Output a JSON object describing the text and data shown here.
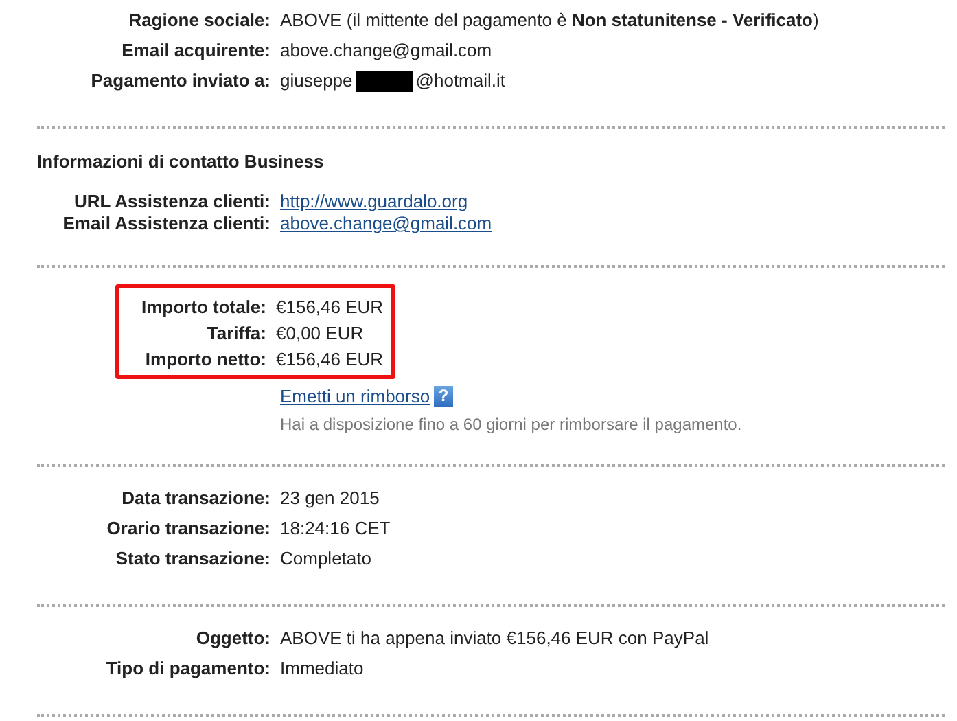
{
  "sections": [
    {
      "rows": [
        {
          "kind": "text",
          "label": "Ragione sociale:",
          "value": "ABOVE (il mittente del pagamento è **Non statunitense - Verificato**)"
        },
        {
          "kind": "text",
          "label": "Email acquirente:",
          "value": "above.change@gmail.com"
        },
        {
          "kind": "redacted",
          "label": "Pagamento inviato a:",
          "value": "giuseppe",
          "value_after": "@hotmail.it"
        }
      ]
    },
    {
      "heading": "Informazioni di contatto Business",
      "rows": [
        {
          "kind": "link",
          "label": "URL Assistenza clienti:",
          "value": "http://www.guardalo.org"
        },
        {
          "kind": "link",
          "label": "Email Assistenza clienti:",
          "value": "above.change@gmail.com"
        }
      ]
    },
    {
      "highlighted": true,
      "rows": [
        {
          "kind": "text",
          "label": "Importo totale:",
          "value": "€156,46 EUR"
        },
        {
          "kind": "text",
          "label": "Tariffa:",
          "value": "€0,00 EUR"
        },
        {
          "kind": "text",
          "label": "Importo netto:",
          "value": "€156,46 EUR"
        }
      ],
      "refund": {
        "link": "Emetti un rimborso",
        "help": "?",
        "note": "Hai a disposizione fino a 60 giorni per rimborsare il pagamento."
      }
    },
    {
      "rows": [
        {
          "kind": "text",
          "label": "Data transazione:",
          "value": "23 gen 2015"
        },
        {
          "kind": "text",
          "label": "Orario transazione:",
          "value": "18:24:16 CET"
        },
        {
          "kind": "text",
          "label": "Stato transazione:",
          "value": "Completato"
        }
      ]
    },
    {
      "rows": [
        {
          "kind": "text",
          "label": "Oggetto:",
          "value": "ABOVE ti ha appena inviato €156,46 EUR con PayPal"
        },
        {
          "kind": "text",
          "label": "Tipo di pagamento:",
          "value": "Immediato"
        }
      ]
    }
  ]
}
